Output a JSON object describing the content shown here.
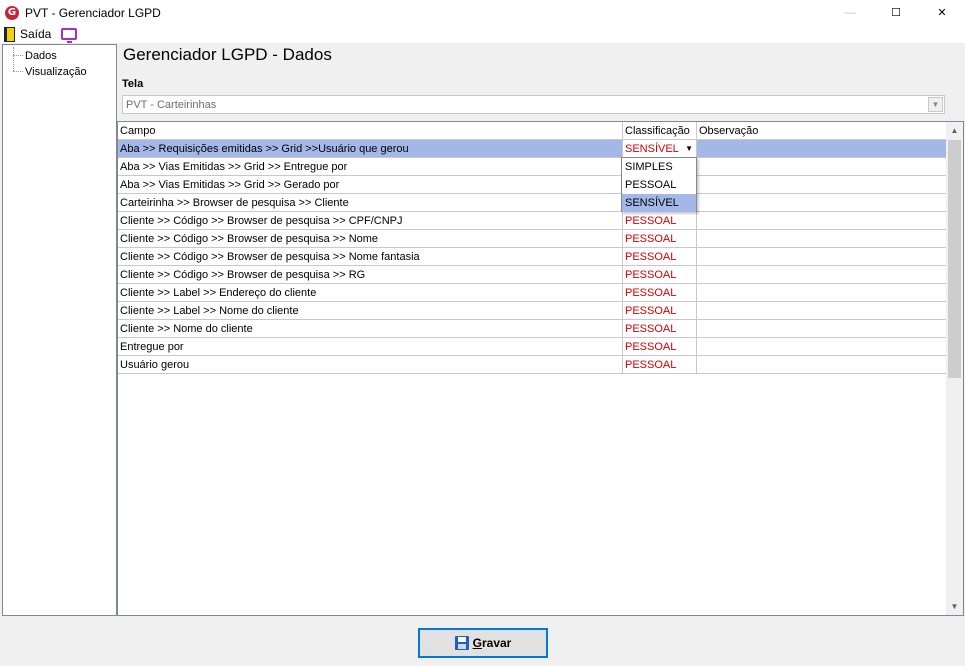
{
  "window": {
    "title": "PVT - Gerenciador LGPD",
    "app_icon_letter": "G",
    "minimize_glyph": "—",
    "maximize_glyph": "☐",
    "close_glyph": "✕"
  },
  "menu": {
    "exit_label": "Saída"
  },
  "tree": {
    "items": [
      "Dados",
      "Visualização"
    ]
  },
  "page": {
    "heading": "Gerenciador LGPD - Dados",
    "tela_label": "Tela",
    "tela_value": "PVT - Carteirinhas"
  },
  "grid": {
    "headers": [
      "Campo",
      "Classificação",
      "Observação"
    ],
    "rows": [
      {
        "campo": "Aba >> Requisições emitidas  >> Grid >>Usuário que gerou",
        "classificacao": "SENSÍVEL",
        "observacao": ""
      },
      {
        "campo": "Aba >> Vias Emitidas >> Grid >> Entregue por",
        "classificacao": "",
        "observacao": ""
      },
      {
        "campo": "Aba >> Vias Emitidas >> Grid >> Gerado por",
        "classificacao": "",
        "observacao": ""
      },
      {
        "campo": "Carteirinha >> Browser de pesquisa >> Cliente",
        "classificacao": "",
        "observacao": ""
      },
      {
        "campo": "Cliente >> Código >> Browser de pesquisa >> CPF/CNPJ",
        "classificacao": "PESSOAL",
        "observacao": ""
      },
      {
        "campo": "Cliente >> Código >> Browser de pesquisa >> Nome",
        "classificacao": "PESSOAL",
        "observacao": ""
      },
      {
        "campo": "Cliente >> Código >> Browser de pesquisa >> Nome fantasia",
        "classificacao": "PESSOAL",
        "observacao": ""
      },
      {
        "campo": "Cliente >> Código >> Browser de pesquisa >> RG",
        "classificacao": "PESSOAL",
        "observacao": ""
      },
      {
        "campo": "Cliente >> Label >> Endereço do cliente",
        "classificacao": "PESSOAL",
        "observacao": ""
      },
      {
        "campo": "Cliente >> Label >> Nome do cliente",
        "classificacao": "PESSOAL",
        "observacao": ""
      },
      {
        "campo": "Cliente >> Nome do cliente",
        "classificacao": "PESSOAL",
        "observacao": ""
      },
      {
        "campo": "Entregue por",
        "classificacao": "PESSOAL",
        "observacao": ""
      },
      {
        "campo": "Usuário gerou",
        "classificacao": "PESSOAL",
        "observacao": ""
      }
    ],
    "dropdown_options": [
      "SIMPLES",
      "PESSOAL",
      "SENSÍVEL"
    ],
    "dropdown_selected": "SENSÍVEL"
  },
  "footer": {
    "save_label": "Gravar"
  },
  "colors": {
    "selection": "#a3b8e8",
    "classification_text": "#d40000",
    "focus_border": "#0078d7"
  },
  "icons": {
    "app": "app-logo-icon",
    "exit": "exit-door-icon",
    "screen": "monitor-icon",
    "save": "floppy-disk-icon"
  }
}
